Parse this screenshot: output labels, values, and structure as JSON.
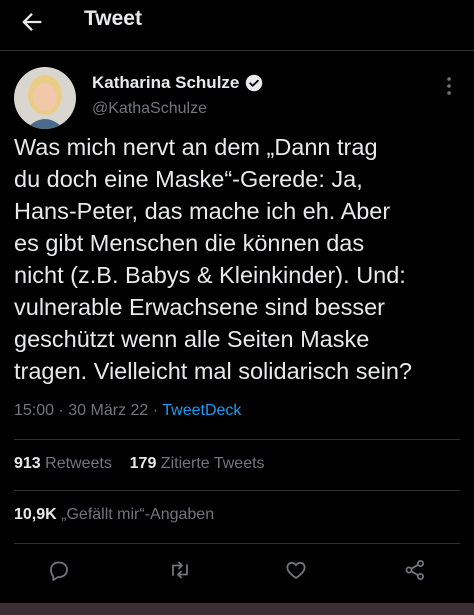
{
  "header": {
    "title": "Tweet",
    "back_icon": "arrow-left-icon"
  },
  "author": {
    "name": "Katharina Schulze",
    "handle": "@KathaSchulze",
    "verified": true
  },
  "tweet": {
    "text": "Was mich nervt an dem „Dann trag\ndu doch eine Maske“-Gerede: Ja,\nHans-Peter, das mache ich eh. Aber\nes gibt Menschen die können das\nnicht (z.B. Babys & Kleinkinder). Und:\nvulnerable Erwachsene sind besser\ngeschützt wenn alle Seiten Maske\ntragen. Vielleicht mal solidarisch sein?",
    "time": "15:00",
    "date": "30 März 22",
    "separator": "·",
    "source": "TweetDeck"
  },
  "stats": {
    "retweets_count": "913",
    "retweets_label": "Retweets",
    "quotes_count": "179",
    "quotes_label": "Zitierte Tweets",
    "likes_count": "10,9K",
    "likes_label": "„Gefällt mir“-Angaben"
  },
  "actions": [
    "reply-icon",
    "retweet-icon",
    "like-icon",
    "share-icon"
  ],
  "colors": {
    "background": "#000000",
    "text": "#e7e9ea",
    "secondary": "#71767b",
    "accent": "#1d9bf0"
  }
}
